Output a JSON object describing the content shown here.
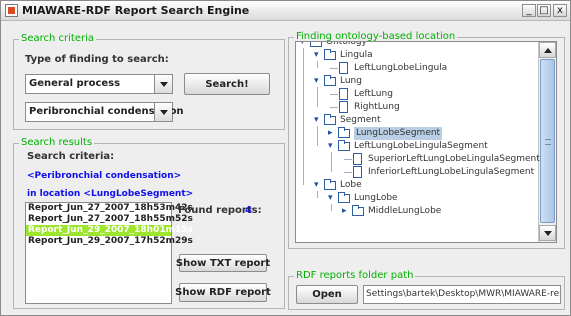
{
  "window": {
    "title": "MIAWARE-RDF Report Search Engine",
    "minimize": "_",
    "maximize": "□",
    "close": "x"
  },
  "search_criteria_panel": {
    "title": "Search criteria",
    "type_label": "Type of finding to search:",
    "finding_type": "General process",
    "finding_value": "Peribronchial condensation",
    "search_button": "Search!"
  },
  "search_results_panel": {
    "title": "Search results",
    "criteria_label": "Search criteria:",
    "criteria_finding": "<Peribronchial condensation>",
    "criteria_location": "in location <LungLobeSegment>",
    "reports": [
      "Report_Jun_27_2007_18h53m42s",
      "Report_Jun_27_2007_18h55m52s",
      "Report_Jun_29_2007_18h01m15s",
      "Report_Jun_29_2007_17h52m29s"
    ],
    "selected_index": 2,
    "found_label": "Found reports:",
    "found_count": "4",
    "show_txt_button": "Show TXT report",
    "show_rdf_button": "Show RDF report"
  },
  "ontology_panel": {
    "title": "Finding ontology-based location",
    "tree": [
      {
        "label": "Ontology",
        "type": "folder",
        "depth": 0,
        "expanded": true
      },
      {
        "label": "Lingula",
        "type": "folder",
        "depth": 1,
        "expanded": true
      },
      {
        "label": "LeftLungLobeLingula",
        "type": "file",
        "depth": 2
      },
      {
        "label": "Lung",
        "type": "folder",
        "depth": 1,
        "expanded": true
      },
      {
        "label": "LeftLung",
        "type": "file",
        "depth": 2
      },
      {
        "label": "RightLung",
        "type": "file",
        "depth": 2
      },
      {
        "label": "Segment",
        "type": "folder",
        "depth": 1,
        "expanded": true
      },
      {
        "label": "LungLobeSegment",
        "type": "folder",
        "depth": 2,
        "expanded": false,
        "selected": true
      },
      {
        "label": "LeftLungLobeLingulaSegment",
        "type": "folder",
        "depth": 2,
        "expanded": true
      },
      {
        "label": "SuperiorLeftLungLobeLingulaSegment",
        "type": "file",
        "depth": 3
      },
      {
        "label": "InferiorLeftLungLobeLingulaSegment",
        "type": "file",
        "depth": 3
      },
      {
        "label": "Lobe",
        "type": "folder",
        "depth": 1,
        "expanded": true
      },
      {
        "label": "LungLobe",
        "type": "folder",
        "depth": 2,
        "expanded": true
      },
      {
        "label": "MiddleLungLobe",
        "type": "folder",
        "depth": 3,
        "expanded": false
      }
    ]
  },
  "folder_panel": {
    "title": "RDF reports folder path",
    "open_button": "Open",
    "path": "Settings\\bartek\\Desktop\\MWR\\MIAWARE-reports"
  },
  "icons": {
    "app": "app-icon",
    "expanded": "expanded-toggle-icon",
    "collapsed": "collapsed-toggle-icon",
    "folder": "folder-icon",
    "file": "file-icon"
  },
  "colors": {
    "panel_title": "#00b000",
    "criteria_text": "#1010ee",
    "selected_report": "#9ee62e",
    "tree_selection": "#b8cfe5"
  }
}
